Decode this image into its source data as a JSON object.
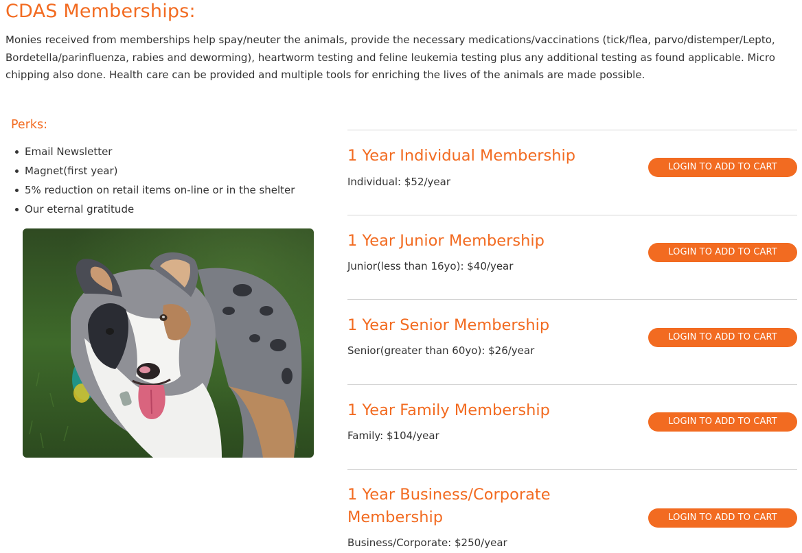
{
  "page": {
    "title": "CDAS Memberships:",
    "intro": "Monies received from memberships help spay/neuter the animals, provide the necessary medications/vaccinations (tick/flea, parvo/distemper/Lepto, Bordetella/parinfluenza, rabies and deworming), heartworm testing and feline leukemia testing plus any additional testing as found applicable. Micro chipping also done.  Health care can be provided and multiple tools for enriching the lives of the animals are made possible."
  },
  "perks": {
    "title": "Perks:",
    "items": [
      "Email Newsletter",
      "Magnet(first year)",
      "5% reduction on retail items on-line or in the shelter",
      "Our eternal gratitude"
    ]
  },
  "photo": {
    "subject": "Australian shepherd dog on grass"
  },
  "memberships": [
    {
      "name": "1 Year Individual Membership",
      "price": "Individual: $52/year",
      "button": "LOGIN TO ADD TO CART"
    },
    {
      "name": "1 Year Junior Membership",
      "price": "Junior(less than 16yo): $40/year",
      "button": "LOGIN TO ADD TO CART"
    },
    {
      "name": "1 Year Senior Membership",
      "price": "Senior(greater than 60yo): $26/year",
      "button": "LOGIN TO ADD TO CART"
    },
    {
      "name": "1 Year Family Membership",
      "price": "Family: $104/year",
      "button": "LOGIN TO ADD TO CART"
    },
    {
      "name": "1 Year Business/Corporate Membership",
      "price": "Business/Corporate: $250/year",
      "button": "LOGIN TO ADD TO CART"
    }
  ],
  "colors": {
    "accent": "#f26b21",
    "text": "#333333",
    "divider": "#d4d4d4"
  }
}
